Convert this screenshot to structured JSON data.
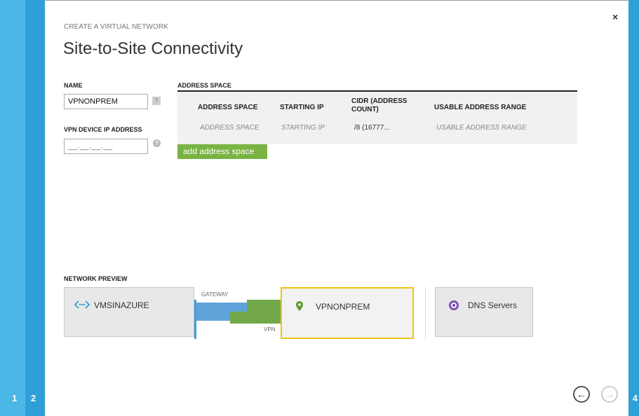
{
  "wizard": {
    "steps": [
      "1",
      "2"
    ],
    "last_step": "4",
    "close_glyph": "×",
    "kicker": "CREATE A VIRTUAL NETWORK",
    "title": "Site-to-Site Connectivity"
  },
  "form": {
    "name_label": "NAME",
    "name_value": "VPNONPREM",
    "name_badge": "?",
    "ip_label": "VPN DEVICE IP ADDRESS",
    "ip_value": "__.__.__.__",
    "help_glyph": "?"
  },
  "address_space": {
    "section_label": "ADDRESS SPACE",
    "columns": [
      "ADDRESS SPACE",
      "STARTING IP",
      "CIDR (ADDRESS COUNT)",
      "USABLE ADDRESS RANGE"
    ],
    "row": {
      "address_space": "ADDRESS SPACE",
      "starting_ip": "STARTING IP",
      "cidr": "/8 (16777...",
      "usable_range": "USABLE ADDRESS RANGE"
    },
    "add_button": "add address space"
  },
  "preview": {
    "label": "NETWORK PREVIEW",
    "azure_network": "VMSINAZURE",
    "onprem_network": "VPNONPREM",
    "dns": "DNS Servers",
    "gateway_label": "GATEWAY",
    "vpn_label": "VPN"
  },
  "nav": {
    "prev_glyph": "←",
    "next_glyph": "→"
  },
  "colors": {
    "accent_blue": "#2f9fd8",
    "light_blue": "#4ab7e7",
    "green": "#79b342",
    "highlight": "#f0c30f",
    "dns_purple": "#7b4fb4"
  },
  "icons": [
    "vnet-icon",
    "location-pin-icon",
    "dns-icon",
    "close-icon",
    "help-icon",
    "back-arrow-icon",
    "next-arrow-icon"
  ]
}
